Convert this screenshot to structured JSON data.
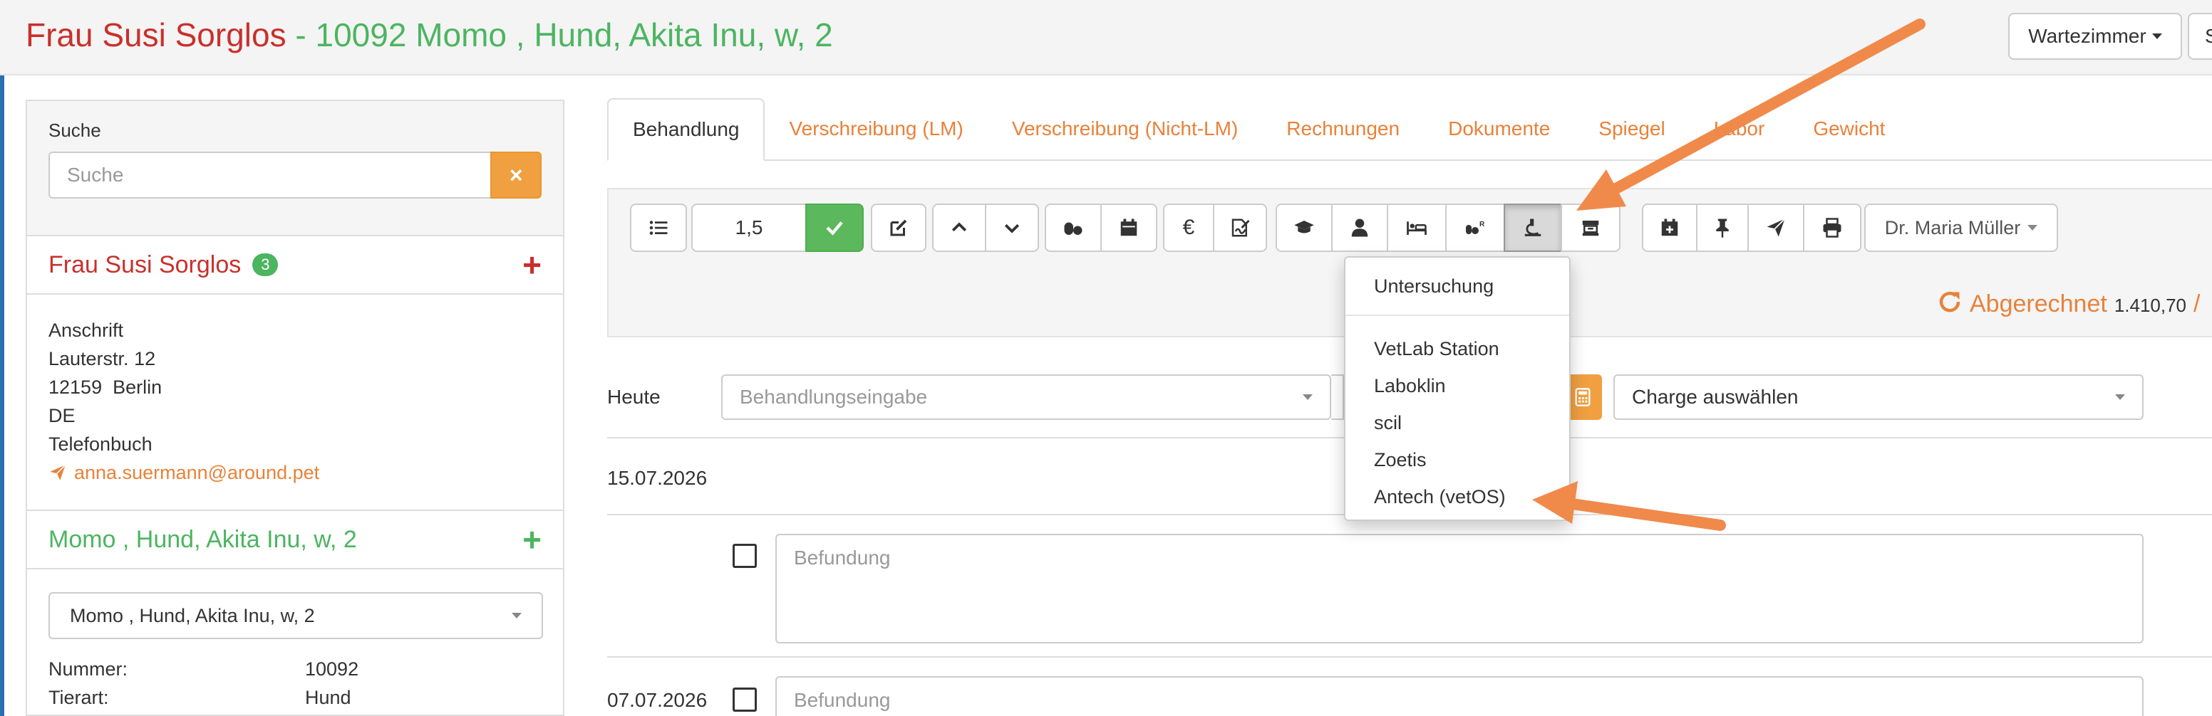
{
  "header": {
    "owner": "Frau Susi Sorglos",
    "separator": " - ",
    "patient": "10092 Momo , Hund, Akita Inu, w, 2",
    "waiting_room_label": "Wartezimmer",
    "cut_button_label": "S"
  },
  "sidebar": {
    "search_label": "Suche",
    "search_placeholder": "Suche",
    "search_clear": "×",
    "owner_name": "Frau Susi Sorglos",
    "owner_badge": "3",
    "address_heading": "Anschrift",
    "street": "Lauterstr. 12",
    "city": "12159  Berlin",
    "country": "DE",
    "phonebook": "Telefonbuch",
    "email": "anna.suermann@around.pet",
    "pet_title": "Momo , Hund, Akita Inu, w, 2",
    "pet_select_value": "Momo , Hund, Akita Inu, w, 2",
    "info": [
      {
        "key": "Nummer:",
        "value": "10092"
      },
      {
        "key": "Tierart:",
        "value": "Hund"
      }
    ]
  },
  "tabs": [
    {
      "label": "Behandlung",
      "active": true
    },
    {
      "label": "Verschreibung (LM)"
    },
    {
      "label": "Verschreibung (Nicht-LM)"
    },
    {
      "label": "Rechnungen"
    },
    {
      "label": "Dokumente"
    },
    {
      "label": "Spiegel"
    },
    {
      "label": "Labor"
    },
    {
      "label": "Gewicht"
    }
  ],
  "toolbar": {
    "quantity": "1,5",
    "doctor": "Dr. Maria Müller",
    "icons": [
      "list-icon",
      "check-icon",
      "edit-icon",
      "chevron-up-icon",
      "chevron-down-icon",
      "pills-icon",
      "calendar-icon",
      "euro-icon",
      "signature-icon",
      "graduation-cap-icon",
      "user-icon",
      "bed-icon",
      "pills-r-icon",
      "lab-icon",
      "cash-register-icon",
      "calendar-plus-icon",
      "pin-icon",
      "send-icon",
      "print-icon"
    ]
  },
  "billing": {
    "status": "Abgerechnet",
    "amount": "1.410,70",
    "slash": "/"
  },
  "entry": {
    "today_label": "Heute",
    "treatment_placeholder": "Behandlungseingabe",
    "charge_placeholder": "Charge auswählen"
  },
  "records": [
    {
      "date": "15.07.2026",
      "finding_placeholder": "Befundung"
    },
    {
      "date": "07.07.2026",
      "finding_placeholder": "Befundung"
    }
  ],
  "lab_dropdown": {
    "items": [
      "Untersuchung",
      "VetLab Station",
      "Laboklin",
      "scil",
      "Zoetis",
      "Antech (vetOS)"
    ]
  },
  "colors": {
    "owner_red": "#c9302c",
    "patient_green": "#4cb560",
    "accent_orange": "#e8823a",
    "confirm_green": "#5cb85c"
  }
}
